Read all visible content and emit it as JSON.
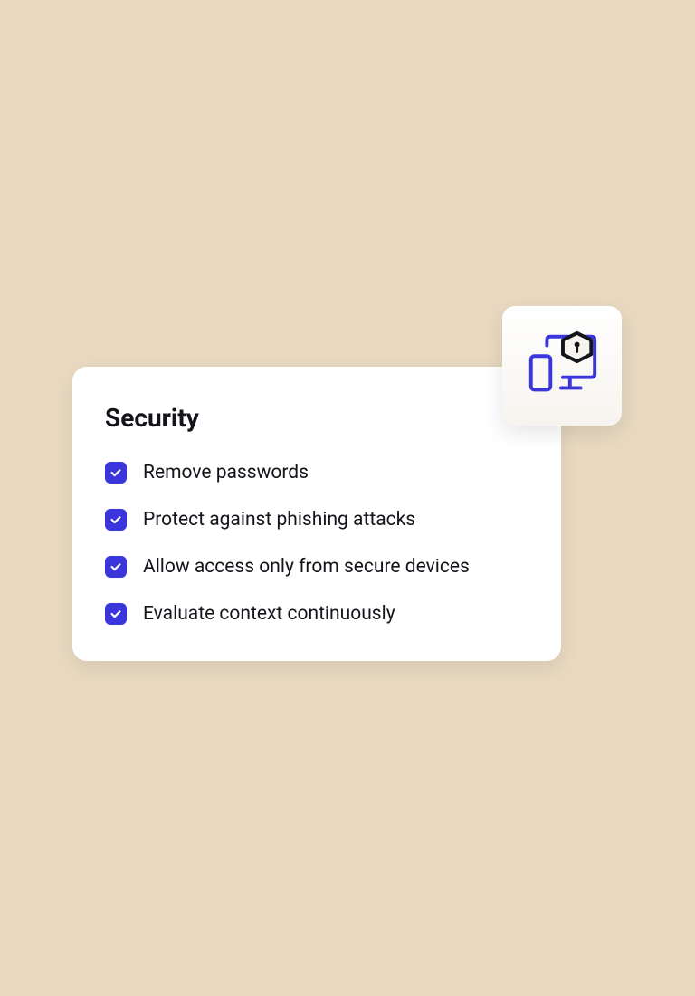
{
  "card": {
    "title": "Security",
    "items": [
      {
        "label": "Remove passwords",
        "checked": true
      },
      {
        "label": "Protect against phishing attacks",
        "checked": true
      },
      {
        "label": "Allow access only from secure devices",
        "checked": true
      },
      {
        "label": "Evaluate context continuously",
        "checked": true
      }
    ]
  },
  "colors": {
    "accent": "#3a36db",
    "background": "#e8d9c0",
    "card": "#ffffff",
    "text": "#14151a"
  }
}
